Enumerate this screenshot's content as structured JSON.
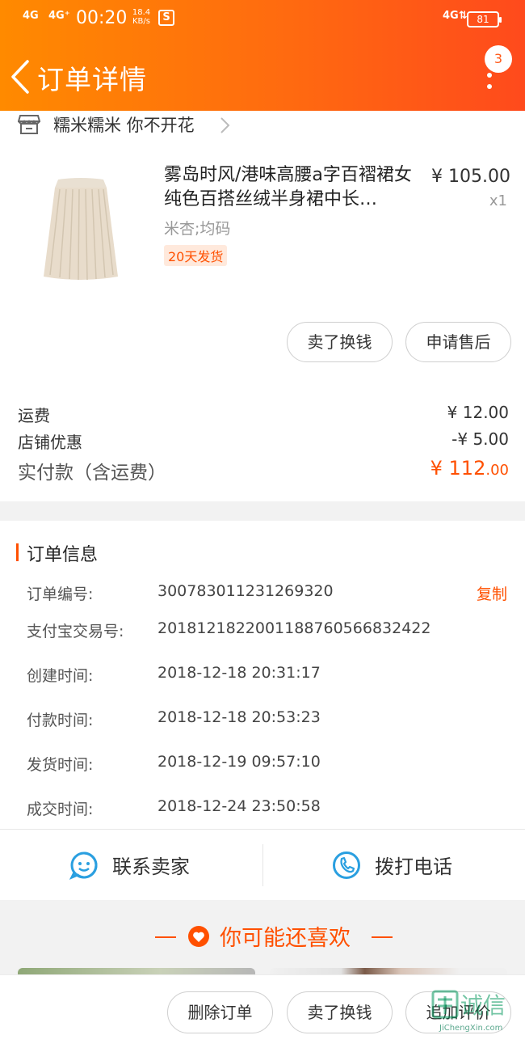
{
  "statusbar": {
    "signal1": "4G",
    "signal2": "4G⁺",
    "time": "00:20",
    "speed_value": "18.4",
    "speed_unit": "KB/s",
    "s_icon": "S",
    "signal3": "4G⇅",
    "battery": "81"
  },
  "header": {
    "title": "订单详情",
    "notification_count": "3",
    "colors": {
      "gradient_start": "#ff8a00",
      "gradient_end": "#ff4a1c"
    }
  },
  "shop": {
    "name": "糯米糯米 你不开花"
  },
  "product": {
    "title": "雾岛时风/港味高腰a字百褶裙女纯色百搭丝绒半身裙中长…",
    "sku": "米杏;均码",
    "tag": "20天发货",
    "price": "¥ 105.00",
    "quantity": "x1",
    "buttons": {
      "sell": "卖了换钱",
      "after_sale": "申请售后"
    }
  },
  "fees": {
    "shipping_label": "运费",
    "shipping_value": "¥ 12.00",
    "discount_label": "店铺优惠",
    "discount_value": "-¥ 5.00",
    "total_label": "实付款（含运费）",
    "total_integer": "¥ 112",
    "total_cents": ".00"
  },
  "order_info": {
    "title": "订单信息",
    "copy_label": "复制",
    "rows": [
      {
        "label": "订单编号:",
        "value": "300783011231269320"
      },
      {
        "label": "支付宝交易号:",
        "value": "2018121822001188760566832422"
      },
      {
        "label": "创建时间:",
        "value": "2018-12-18 20:31:17"
      },
      {
        "label": "付款时间:",
        "value": "2018-12-18 20:53:23"
      },
      {
        "label": "发货时间:",
        "value": "2018-12-19 09:57:10"
      },
      {
        "label": "成交时间:",
        "value": "2018-12-24 23:50:58"
      }
    ]
  },
  "contact": {
    "seller_label": "联系卖家",
    "phone_label": "拨打电话"
  },
  "recommend": {
    "title": "你可能还喜欢"
  },
  "bottom_bar": {
    "delete": "删除订单",
    "sell": "卖了换钱",
    "review": "追加评价"
  },
  "watermark": {
    "cn": "诚信",
    "en": "JiChengXin.com"
  },
  "accent_color": "#ff5000"
}
